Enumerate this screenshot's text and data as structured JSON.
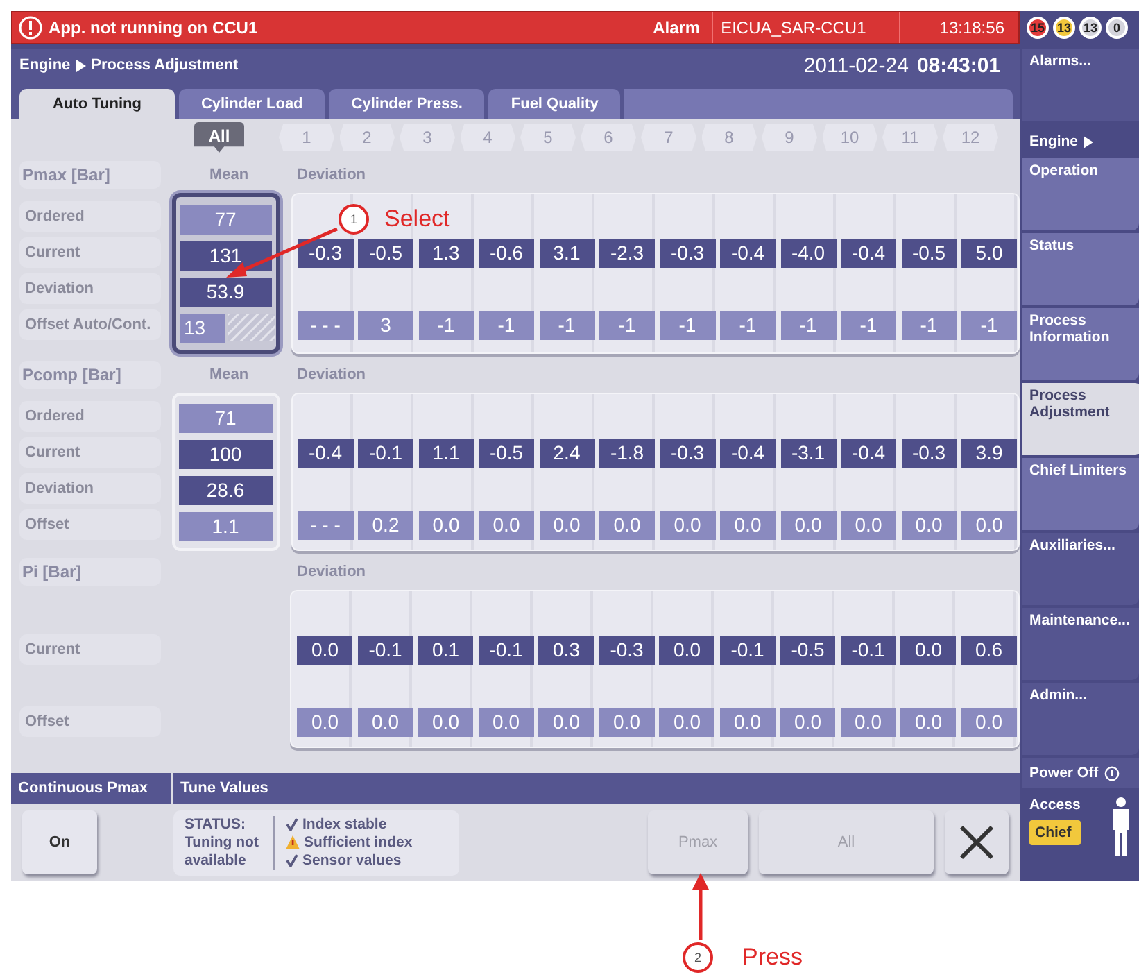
{
  "alarm_bar": {
    "message": "App. not running on CCU1",
    "label": "Alarm",
    "source": "EICUA_SAR-CCU1",
    "time": "13:18:56",
    "counters": [
      {
        "text": "15",
        "color": "#e23a3a"
      },
      {
        "text": "13",
        "color": "#f2c83c"
      },
      {
        "text": "13",
        "color": "#d4d4dc"
      },
      {
        "text": "0",
        "color": "#d4d4dc"
      }
    ]
  },
  "header": {
    "breadcrumb": [
      "Engine",
      "Process Adjustment"
    ],
    "date": "2011-02-24",
    "time": "08:43:01"
  },
  "tabs": [
    {
      "label": "Auto Tuning",
      "selected": true
    },
    {
      "label": "Cylinder Load",
      "selected": false
    },
    {
      "label": "Cylinder Press.",
      "selected": false
    },
    {
      "label": "Fuel Quality",
      "selected": false
    }
  ],
  "cylinders": {
    "all": "All",
    "numbers": [
      "1",
      "2",
      "3",
      "4",
      "5",
      "6",
      "7",
      "8",
      "9",
      "10",
      "11",
      "12"
    ]
  },
  "sections": [
    {
      "title": "Pmax [Bar]",
      "mean_header": "Mean",
      "deviation_header": "Deviation",
      "selected": true,
      "rows": [
        {
          "label": "Ordered",
          "kind": "ordered",
          "mean": "77"
        },
        {
          "label": "Current",
          "kind": "current",
          "mean": "131",
          "values": [
            "-0.3",
            "-0.5",
            "1.3",
            "-0.6",
            "3.1",
            "-2.3",
            "-0.3",
            "-0.4",
            "-4.0",
            "-0.4",
            "-0.5",
            "5.0"
          ]
        },
        {
          "label": "Deviation",
          "kind": "deviation",
          "mean": "53.9"
        },
        {
          "label": "Offset Auto/Cont.",
          "kind": "offset_auto",
          "mean": "13",
          "values": [
            "- - -",
            "3",
            "-1",
            "-1",
            "-1",
            "-1",
            "-1",
            "-1",
            "-1",
            "-1",
            "-1",
            "-1"
          ]
        }
      ]
    },
    {
      "title": "Pcomp [Bar]",
      "mean_header": "Mean",
      "deviation_header": "Deviation",
      "selected": false,
      "rows": [
        {
          "label": "Ordered",
          "kind": "ordered",
          "mean": "71"
        },
        {
          "label": "Current",
          "kind": "current",
          "mean": "100",
          "values": [
            "-0.4",
            "-0.1",
            "1.1",
            "-0.5",
            "2.4",
            "-1.8",
            "-0.3",
            "-0.4",
            "-3.1",
            "-0.4",
            "-0.3",
            "3.9"
          ]
        },
        {
          "label": "Deviation",
          "kind": "deviation",
          "mean": "28.6"
        },
        {
          "label": "Offset",
          "kind": "offset",
          "mean": "1.1",
          "values": [
            "- - -",
            "0.2",
            "0.0",
            "0.0",
            "0.0",
            "0.0",
            "0.0",
            "0.0",
            "0.0",
            "0.0",
            "0.0",
            "0.0"
          ]
        }
      ]
    },
    {
      "title": "Pi [Bar]",
      "deviation_header": "Deviation",
      "rows": [
        {
          "kind": "spacer"
        },
        {
          "label": "Current",
          "kind": "current",
          "values": [
            "0.0",
            "-0.1",
            "0.1",
            "-0.1",
            "0.3",
            "-0.3",
            "0.0",
            "-0.1",
            "-0.5",
            "-0.1",
            "0.0",
            "0.6"
          ]
        },
        {
          "kind": "spacer"
        },
        {
          "label": "Offset",
          "kind": "offset",
          "values": [
            "0.0",
            "0.0",
            "0.0",
            "0.0",
            "0.0",
            "0.0",
            "0.0",
            "0.0",
            "0.0",
            "0.0",
            "0.0",
            "0.0"
          ]
        }
      ]
    }
  ],
  "continuous_pmax": {
    "title": "Continuous Pmax",
    "button": "On"
  },
  "tune_values": {
    "title": "Tune Values",
    "status_heading": "STATUS:",
    "status": "Tuning not available",
    "checks": [
      {
        "text": "Index stable",
        "kind": "ok"
      },
      {
        "text": "Sufficient index",
        "kind": "warning"
      },
      {
        "text": "Sensor values",
        "kind": "ok"
      }
    ],
    "buttons": [
      {
        "kind": "text",
        "label": "Pmax",
        "disabled": true
      },
      {
        "kind": "text",
        "label": "All",
        "disabled": true
      },
      {
        "kind": "close",
        "disabled": false
      }
    ]
  },
  "sidebar": {
    "alarms_button": "Alarms...",
    "group_title": "Engine",
    "items": [
      {
        "label": "Operation",
        "kind": "page",
        "selected": false
      },
      {
        "label": "Status",
        "kind": "page",
        "selected": false
      },
      {
        "label": "Process Information",
        "kind": "page",
        "selected": false
      },
      {
        "label": "Process Adjustment",
        "kind": "page",
        "selected": true
      },
      {
        "label": "Chief Limiters",
        "kind": "page",
        "selected": false
      },
      {
        "label": "Auxiliaries...",
        "kind": "dialog",
        "selected": false
      },
      {
        "label": "Maintenance...",
        "kind": "dialog",
        "selected": false
      },
      {
        "label": "Admin...",
        "kind": "dialog",
        "selected": false
      }
    ],
    "power_off": "Power Off",
    "access": {
      "label": "Access",
      "role": "Chief"
    }
  },
  "annotations": [
    {
      "number": "1",
      "text": "Select"
    },
    {
      "number": "2",
      "text": "Press"
    }
  ]
}
